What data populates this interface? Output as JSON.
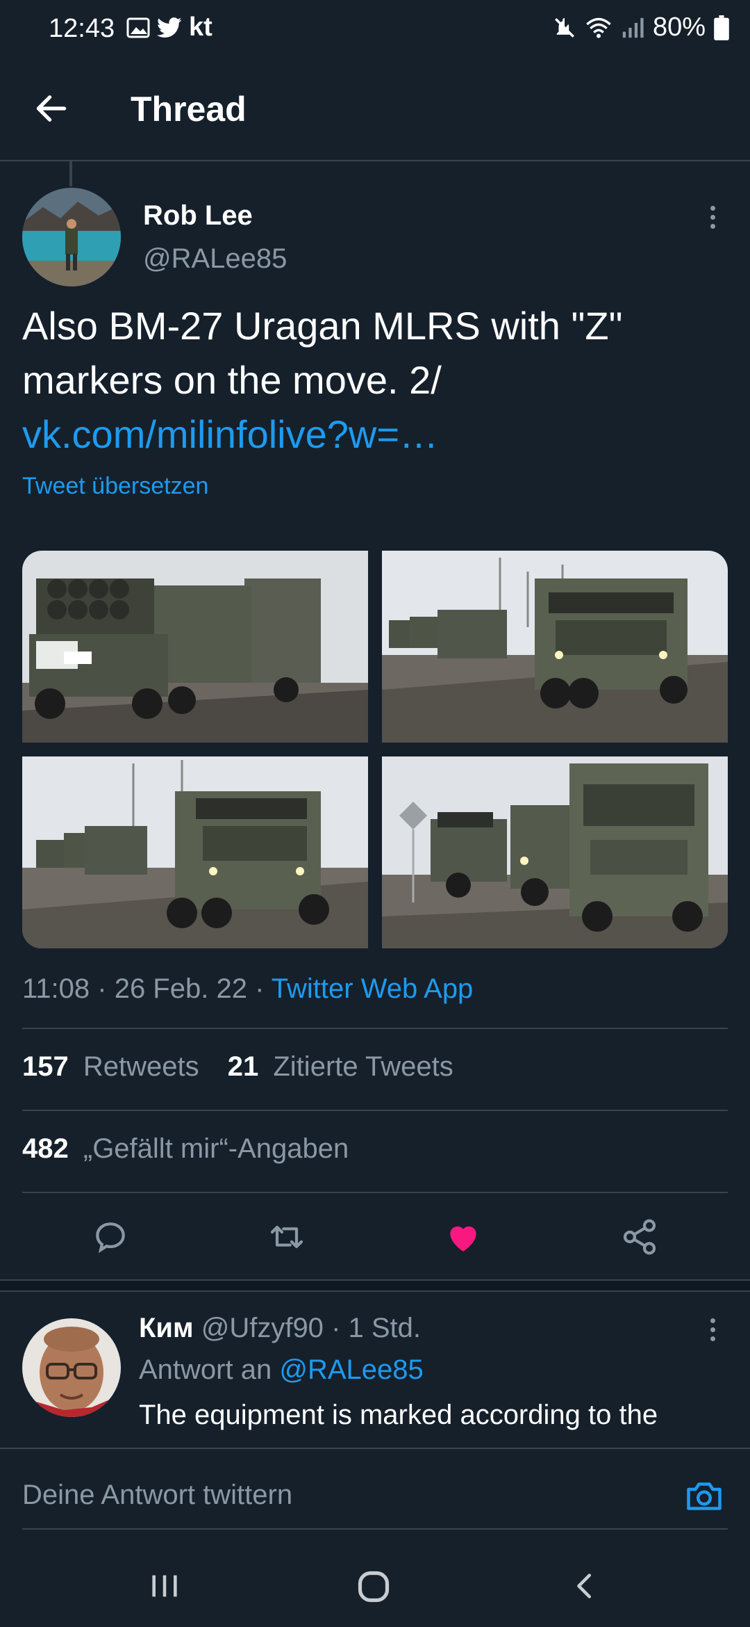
{
  "status_bar": {
    "time": "12:43",
    "left_extra": "kt",
    "battery": "80%"
  },
  "header": {
    "title": "Thread"
  },
  "tweet": {
    "author_name": "Rob Lee",
    "author_handle": "@RALee85",
    "text_line1": "Also BM-27 Uragan MLRS with \"Z\"",
    "text_line2": "markers on the move. 2/",
    "link": "vk.com/milinfolive?w=…",
    "translate_label": "Tweet übersetzen",
    "time": "11:08",
    "date": "26 Feb. 22",
    "client": "Twitter Web App",
    "retweets_count": "157",
    "retweets_label": "Retweets",
    "quotes_count": "21",
    "quotes_label": "Zitierte Tweets",
    "likes_count": "482",
    "likes_label": "„Gefällt mir“-Angaben"
  },
  "reply": {
    "name": "Ким",
    "handle": "@Ufzyf90",
    "time": "1 Std.",
    "reply_to_label": "Antwort an",
    "reply_to_handle": "@RALee85",
    "text": "The equipment is marked according to the"
  },
  "compose": {
    "placeholder": "Deine Antwort twittern"
  },
  "colors": {
    "background": "#15202b",
    "accent": "#1d9bf0",
    "like": "#f91880",
    "muted": "#8b98a5"
  }
}
